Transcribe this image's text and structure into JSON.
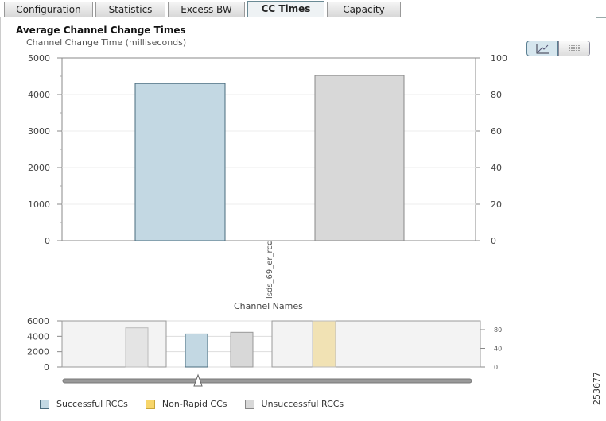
{
  "tabs": [
    "Configuration",
    "Statistics",
    "Excess BW",
    "CC Times",
    "Capacity"
  ],
  "active_tab": "CC Times",
  "view_buttons": {
    "line": "line-chart-icon",
    "table": "table-icon"
  },
  "figure_number": "253677",
  "chart_data": {
    "type": "bar",
    "title": "Average Channel Change Times",
    "ylabel": "Channel Change Time (milliseconds)",
    "xlabel": "Channel Names",
    "categories": [
      "lsds_69_er_rcc"
    ],
    "ylim": [
      0,
      5000
    ],
    "yticks": [
      "0",
      "1000",
      "2000",
      "3000",
      "4000",
      "5000"
    ],
    "y2lim": [
      0,
      100
    ],
    "y2ticks": [
      "0",
      "20",
      "40",
      "60",
      "80",
      "100"
    ],
    "series": [
      {
        "name": "Successful RCCs",
        "values": [
          4300
        ],
        "color": "#c3d8e3"
      },
      {
        "name": "Non-Rapid CCs",
        "values": [
          0
        ],
        "color": "#f7d56a"
      },
      {
        "name": "Unsuccessful RCCs",
        "values": [
          4520
        ],
        "color": "#d8d8d8"
      }
    ],
    "overview": {
      "ylim": [
        0,
        6000
      ],
      "yticks": [
        "0",
        "2000",
        "4000",
        "6000"
      ],
      "y2ticks": [
        "0",
        "40",
        "80"
      ],
      "bars": [
        {
          "series": "Unsuccessful RCCs",
          "value": 5100,
          "faded": true
        },
        {
          "series": "Successful RCCs",
          "value": 4300,
          "faded": false
        },
        {
          "series": "Unsuccessful RCCs",
          "value": 4520,
          "faded": false
        },
        {
          "series": "Non-Rapid CCs",
          "value": 6000,
          "faded": true
        }
      ]
    },
    "grid": true,
    "legend": "bottom-left"
  }
}
